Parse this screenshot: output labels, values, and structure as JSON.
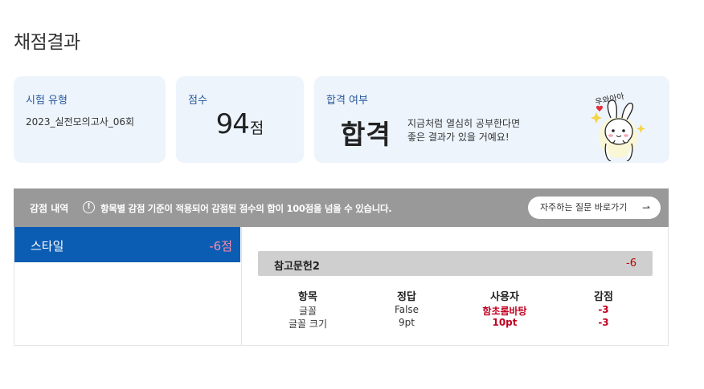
{
  "page": {
    "title": "채점결과"
  },
  "summary": {
    "exam_type": {
      "label": "시험 유형",
      "value": "2023_실전모의고사_06회"
    },
    "score": {
      "label": "점수",
      "value": "94",
      "unit": "점"
    },
    "pass": {
      "label": "합격 여부",
      "result": "합격",
      "message_line1": "지금처럼 열심히 공부한다면",
      "message_line2": "좋은 결과가 있을 거예요!",
      "mascot_caption": "우와아아"
    }
  },
  "deductions": {
    "title": "감점 내역",
    "notice": "항목별 감점 기준이 적용되어 감점된 점수의 합이 100점을 넘을 수 있습니다.",
    "faq_button": "자주하는 질문 바로가기",
    "categories": [
      {
        "name": "스타일",
        "points": "-6점"
      }
    ],
    "detail": {
      "name": "참고문헌2",
      "points": "-6",
      "columns": [
        "항목",
        "정답",
        "사용자",
        "감점"
      ],
      "rows": [
        {
          "item": "글꼴",
          "answer": "False",
          "user": "함초롬바탕",
          "deduction": "-3"
        },
        {
          "item": "글꼴 크기",
          "answer": "9pt",
          "user": "10pt",
          "deduction": "-3"
        }
      ]
    }
  },
  "colors": {
    "accent": "#0b5db3",
    "card_bg": "#edf4fc",
    "header_bg": "#999999",
    "deduction_red": "#c00020",
    "category_points": "#ff8aa8"
  }
}
